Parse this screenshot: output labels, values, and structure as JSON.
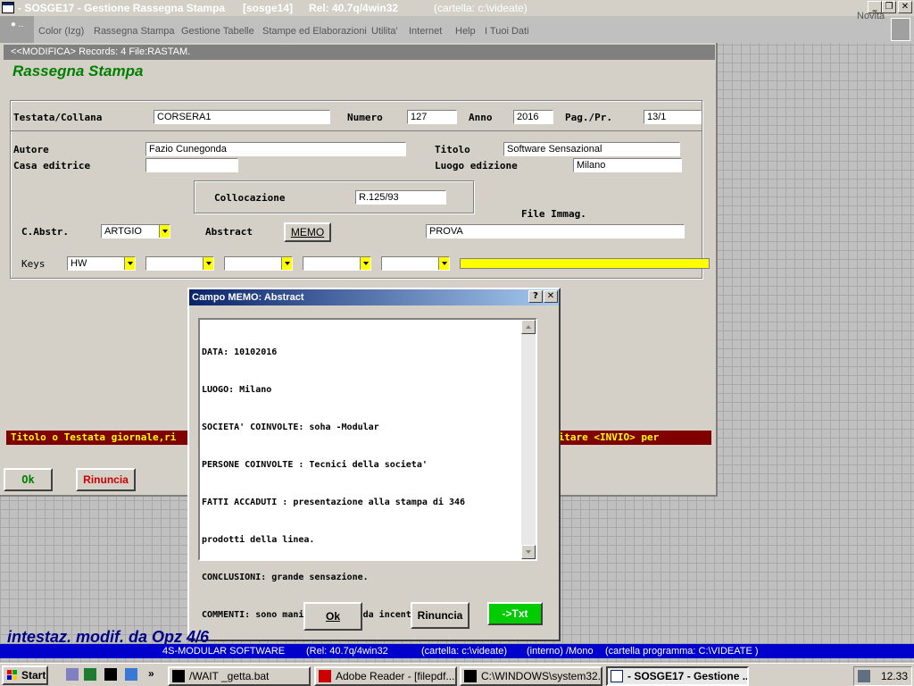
{
  "window": {
    "title": "- SOSGE17 - Gestione Rassegna Stampa",
    "session": "[sosge14]",
    "release": "Rel: 40.7q/4win32",
    "folder": "(cartella: c:\\videate)"
  },
  "menu": {
    "left_tab": "● ..",
    "items": [
      "Color (Izg)",
      "Rassegna Stampa",
      "Gestione Tabelle",
      "Stampe ed Elaborazioni",
      "Utilita'",
      "Internet",
      "Help",
      "I Tuoi Dati"
    ],
    "novita": "Novità"
  },
  "form": {
    "status": "<<MODIFICA> Records: 4 File:RASTAM.",
    "title": "Rassegna Stampa",
    "labels": {
      "testata": "Testata/Collana",
      "numero": "Numero",
      "anno": "Anno",
      "pag": "Pag./Pr.",
      "autore": "Autore",
      "titolo": "Titolo",
      "casa": "Casa editrice",
      "luogo": "Luogo edizione",
      "collocazione": "Collocazione",
      "file_immag": "File Immag.",
      "cabstr": "C.Abstr.",
      "abstract": "Abstract",
      "keys": "Keys"
    },
    "values": {
      "testata": "CORSERA1",
      "numero": "127",
      "anno": "2016",
      "pag": "13/1",
      "autore": "Fazio Cunegonda",
      "titolo": "Software Sensazional",
      "casa": "",
      "luogo": "Milano",
      "collocazione": "R.125/93",
      "cabstr": "ARTGIO",
      "file_immag": "PROVA",
      "key1": "HW",
      "key2": "",
      "key3": "",
      "key4": "",
      "key5": "",
      "key6": ""
    },
    "memo_button": "MEMO",
    "message_left": "Titolo o Testata giornale,ri",
    "message_right": "gitare <INVIO> per",
    "ok_button": "Ok",
    "cancel_button": "Rinuncia"
  },
  "dialog": {
    "title": "Campo MEMO: Abstract",
    "help_btn": "?",
    "close_btn": "✕",
    "lines": [
      "DATA: 10102016",
      "LUOGO: Milano",
      "SOCIETA' COINVOLTE: soha -Modular",
      "PERSONE COINVOLTE : Tecnici della societa'",
      "FATTI ACCADUTI : presentazione alla stampa di 346",
      "prodotti della linea.",
      "CONCLUSIONI: grande sensazione.",
      "COMMENTI: sono manifestazioni da incentivare"
    ],
    "ok_button": "Ok",
    "cancel_button": "Rinuncia",
    "txt_button": "->Txt"
  },
  "bottom": {
    "intestaz": "intestaz. modif. da Opz 4/6",
    "company": "4S-MODULAR SOFTWARE",
    "rel": "(Rel: 40.7q/4win32",
    "cartella": "(cartella: c:\\videate)",
    "interno": "(interno)",
    "mono": "/Mono",
    "programma": "(cartella programma: C:\\VIDEATE )"
  },
  "taskbar": {
    "start": "Start",
    "tasks": [
      "/WAIT _getta.bat",
      "Adobe Reader - [filepdf....",
      "C:\\WINDOWS\\system32....",
      "- SOSGE17 - Gestione ..."
    ],
    "clock": "12.33"
  },
  "colors": {
    "accent_green": "#008000",
    "message_bg": "#800000",
    "info_bar": "#0000cc",
    "key_yellow": "#ffff00"
  }
}
